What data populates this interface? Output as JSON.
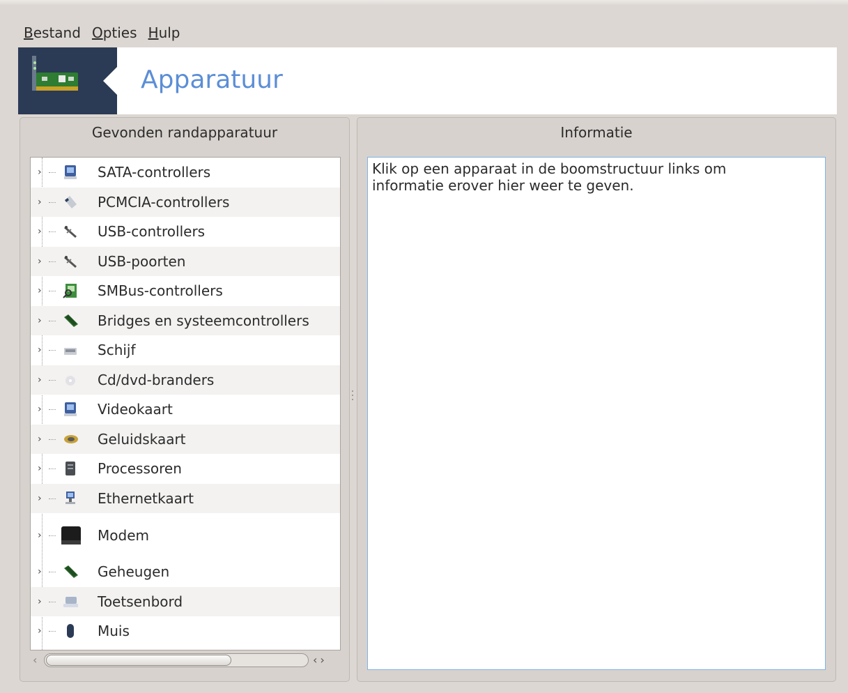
{
  "menu": [
    {
      "accel": "B",
      "rest": "estand"
    },
    {
      "accel": "O",
      "rest": "pties"
    },
    {
      "accel": "H",
      "rest": "ulp"
    }
  ],
  "banner": {
    "title": "Apparatuur",
    "logo_icon": "network-card-icon"
  },
  "left_panel": {
    "header": "Gevonden randapparatuur",
    "items": [
      {
        "label": "SATA-controllers",
        "icon": "disk-controller-icon"
      },
      {
        "label": "PCMCIA-controllers",
        "icon": "pcmcia-icon"
      },
      {
        "label": "USB-controllers",
        "icon": "usb-icon"
      },
      {
        "label": "USB-poorten",
        "icon": "usb-icon"
      },
      {
        "label": "SMBus-controllers",
        "icon": "smbus-icon"
      },
      {
        "label": "Bridges en systeemcontrollers",
        "icon": "memory-module-icon"
      },
      {
        "label": "Schijf",
        "icon": "hard-disk-icon"
      },
      {
        "label": "Cd/dvd-branders",
        "icon": "optical-disc-icon"
      },
      {
        "label": "Videokaart",
        "icon": "video-card-icon"
      },
      {
        "label": "Geluidskaart",
        "icon": "speaker-icon"
      },
      {
        "label": "Processoren",
        "icon": "cpu-icon"
      },
      {
        "label": "Ethernetkaart",
        "icon": "network-computer-icon"
      },
      {
        "label": "Modem",
        "icon": "modem-icon"
      },
      {
        "label": "Geheugen",
        "icon": "memory-module-icon"
      },
      {
        "label": "Toetsenbord",
        "icon": "keyboard-icon"
      },
      {
        "label": "Muis",
        "icon": "mouse-icon"
      }
    ]
  },
  "right_panel": {
    "header": "Informatie",
    "text_line1": "Klik op een apparaat in de boomstructuur links om",
    "text_line2": "informatie erover hier weer te geven."
  },
  "colors": {
    "accent": "#5b8ed6",
    "logo_bg": "#2b3a55",
    "info_border": "#7fb3e6"
  }
}
